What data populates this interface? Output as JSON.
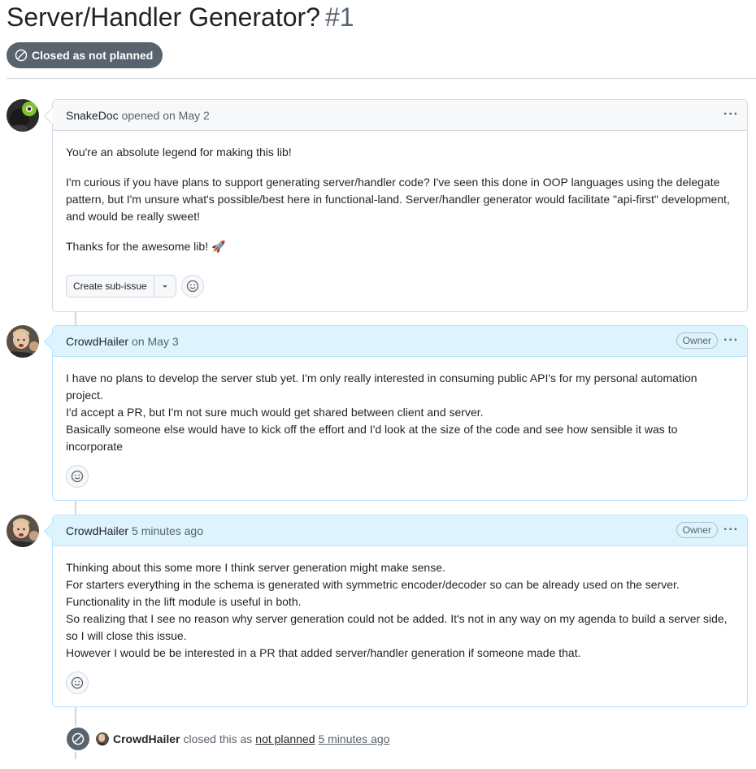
{
  "issue": {
    "title": "Server/Handler Generator?",
    "number": "#1",
    "state_label": "Closed as not planned",
    "state_color": "#59636e"
  },
  "comments": [
    {
      "author": "SnakeDoc",
      "meta": "opened on May 2",
      "paragraphs": [
        "You're an absolute legend for making this lib!",
        "I'm curious if you have plans to support generating server/handler code? I've seen this done in OOP languages using the delegate pattern, but I'm unsure what's possible/best here in functional-land. Server/handler generator would facilitate \"api-first\" development, and would be really sweet!",
        "Thanks for the awesome lib! 🚀"
      ],
      "sub_issue_label": "Create sub-issue"
    },
    {
      "author": "CrowdHailer",
      "meta": "on May 3",
      "badge": "Owner",
      "lines": [
        "I have no plans to develop the server stub yet. I'm only really interested in consuming public API's for my personal automation project.",
        "I'd accept a PR, but I'm not sure much would get shared between client and server.",
        "Basically someone else would have to kick off the effort and I'd look at the size of the code and see how sensible it was to incorporate"
      ]
    },
    {
      "author": "CrowdHailer",
      "meta": "5 minutes ago",
      "badge": "Owner",
      "lines": [
        "Thinking about this some more I think server generation might make sense.",
        "For starters everything in the schema is generated with symmetric encoder/decoder so can be already used on the server.",
        "Functionality in the lift module is useful in both.",
        "So realizing that I see no reason why server generation could not be added. It's not in any way on my agenda to build a server side, so I will close this issue.",
        "However I would be be interested in a PR that added server/handler generation if someone made that."
      ]
    }
  ],
  "close_event": {
    "actor": "CrowdHailer",
    "text": "closed this as",
    "reason": "not planned",
    "time": "5 minutes ago"
  },
  "icons": {
    "state": "circle-slash-icon",
    "kebab": "kebab-horizontal-icon",
    "reaction": "smiley-icon",
    "caret": "triangle-down-icon"
  }
}
